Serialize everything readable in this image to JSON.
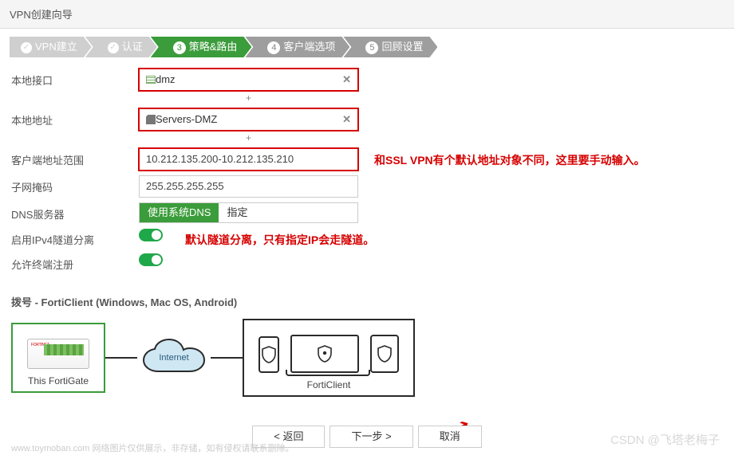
{
  "header": {
    "title": "VPN创建向导"
  },
  "steps": [
    {
      "label": "VPN建立"
    },
    {
      "label": "认证"
    },
    {
      "num": "3",
      "label": "策略&路由"
    },
    {
      "num": "4",
      "label": "客户端选项"
    },
    {
      "num": "5",
      "label": "回顾设置"
    }
  ],
  "form": {
    "local_if": {
      "label": "本地接口",
      "value": "dmz",
      "remove": "✕",
      "plus": "+"
    },
    "local_addr": {
      "label": "本地地址",
      "value": "Servers-DMZ",
      "remove": "✕",
      "plus": "+"
    },
    "client_range": {
      "label": "客户端地址范围",
      "value": "10.212.135.200-10.212.135.210"
    },
    "subnet": {
      "label": "子网掩码",
      "value": "255.255.255.255"
    },
    "dns": {
      "label": "DNS服务器",
      "opt1": "使用系统DNS",
      "opt2": "指定"
    },
    "split": {
      "label": "启用IPv4隧道分离"
    },
    "allow_reg": {
      "label": "允许终端注册"
    }
  },
  "anno": {
    "client_range": "和SSL VPN有个默认地址对象不同，这里要手动输入。",
    "split": "默认隧道分离，只有指定IP会走隧道。"
  },
  "dialup": {
    "title": "拨号 - FortiClient (Windows, Mac OS, Android)",
    "fortigate": "This FortiGate",
    "internet": "Internet",
    "forticlient": "FortiClient"
  },
  "footer": {
    "back": "< 返回",
    "next": "下一步 >",
    "cancel": "取消"
  },
  "watermark": {
    "left": "www.toymoban.com 网络图片仅供展示，非存储，如有侵权请联系删除。",
    "right": "CSDN @飞塔老梅子"
  }
}
